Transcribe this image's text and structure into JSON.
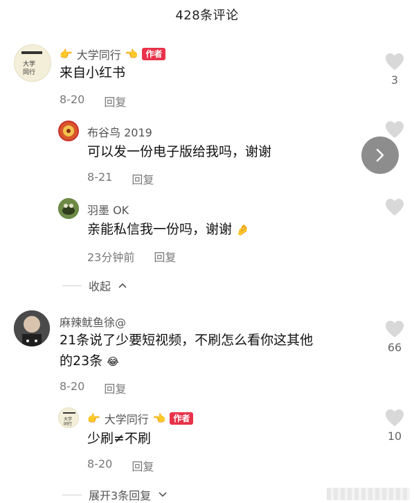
{
  "header": {
    "title": "428条评论"
  },
  "comments": [
    {
      "name": "大学同行",
      "badge": "作者",
      "text": "来自小红书",
      "date": "8-20",
      "reply": "回复",
      "likes": "3",
      "replies": [
        {
          "name": "布谷鸟 2019",
          "text": "可以发一份电子版给我吗，谢谢",
          "date": "8-21",
          "reply": "回复"
        },
        {
          "name": "羽墨 OK",
          "text": "亲能私信我一份吗，谢谢",
          "date": "23分钟前",
          "reply": "回复"
        }
      ],
      "collapse": "收起"
    },
    {
      "name": "麻辣鱿鱼徐@",
      "text_line1": "21条说了少要短视频，不刷怎么看你这其他",
      "text_line2": "的23条",
      "date": "8-20",
      "reply": "回复",
      "likes": "66",
      "replies": [
        {
          "name": "大学同行",
          "badge": "作者",
          "text": "少刷≠不刷",
          "date": "8-20",
          "reply": "回复",
          "likes": "10"
        }
      ],
      "expand": "展开3条回复"
    }
  ],
  "icons": [
    "heart-icon",
    "chevron-right-icon",
    "chevron-up-icon",
    "chevron-down-icon",
    "pointing-hand-icon",
    "crying-laughing-emoji",
    "pinched-fingers-emoji"
  ],
  "colors": {
    "author_badge": "#e8334a",
    "heart": "#d8d8d8"
  }
}
